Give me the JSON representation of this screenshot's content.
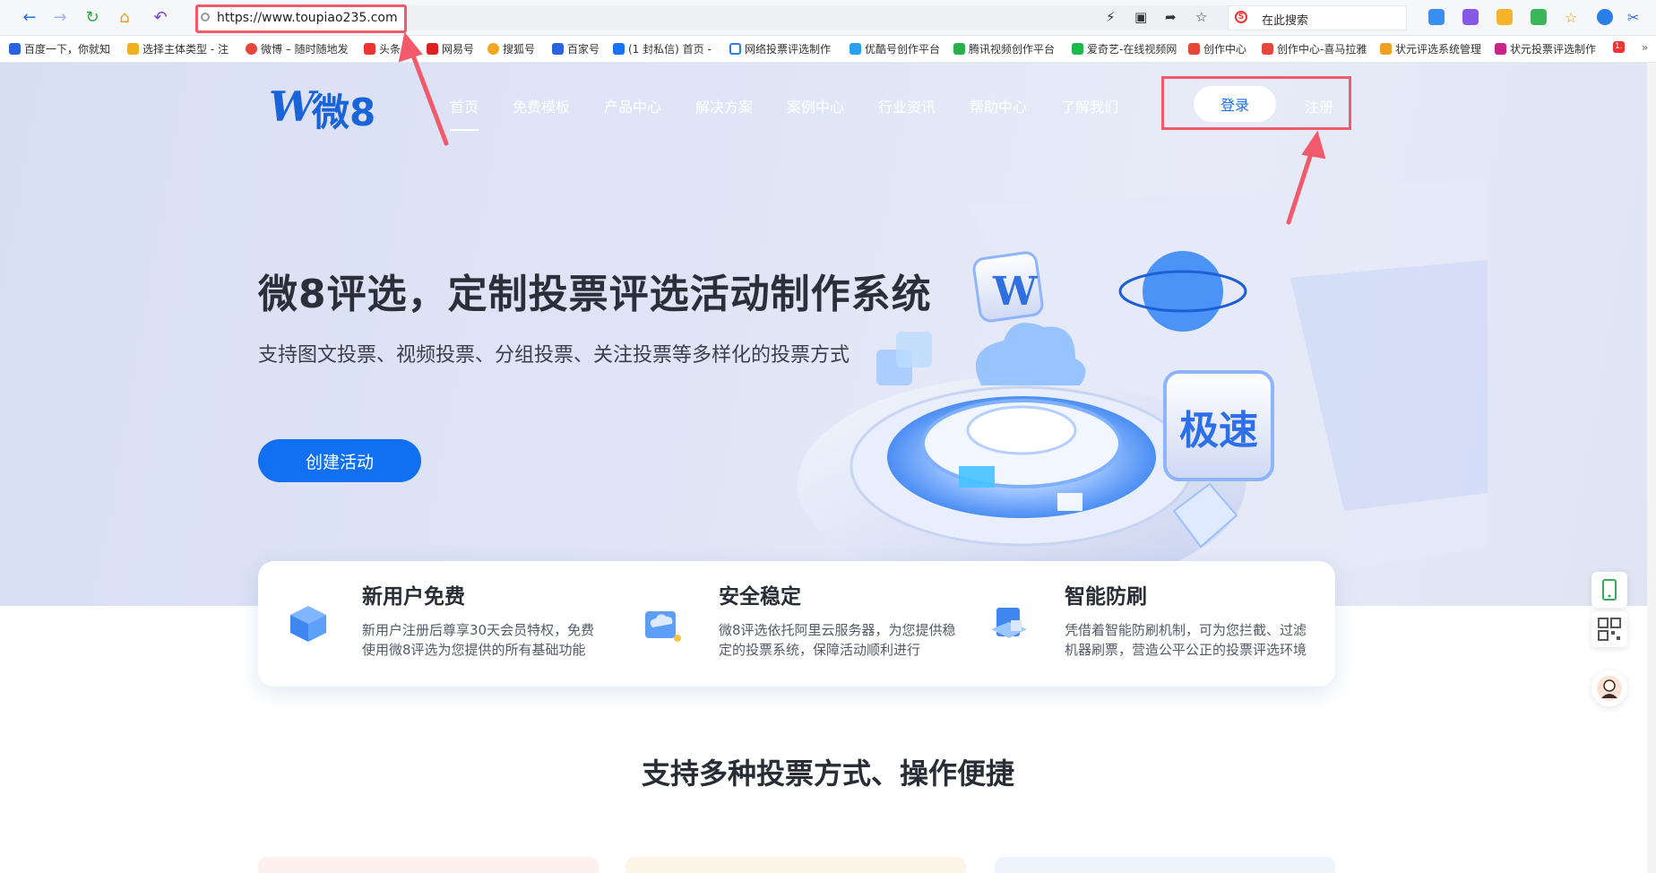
{
  "browser": {
    "url": "https://www.toupiao235.com",
    "search_placeholder": "在此搜索",
    "bookmarks": [
      "百度一下，你就知",
      "选择主体类型 - 注",
      "微博 – 随时随地发",
      "头条号",
      "网易号",
      "搜狐号",
      "百家号",
      "(1 封私信) 首页 -",
      "网络投票评选制作",
      "优酷号创作平台",
      "腾讯视频创作平台",
      "爱奇艺-在线视频网",
      "创作中心",
      "创作中心-喜马拉雅",
      "状元评选系统管理",
      "状元投票评选制作"
    ],
    "bookmark_badge": "1."
  },
  "site": {
    "logo_letter": "W",
    "logo_text": "微8",
    "nav": [
      "首页",
      "免费模板",
      "产品中心",
      "解决方案",
      "案例中心",
      "行业资讯",
      "帮助中心",
      "了解我们"
    ],
    "login_label": "登录",
    "register_label": "注册"
  },
  "hero": {
    "title": "微8评选，定制投票评选活动制作系统",
    "subtitle": "支持图文投票、视频投票、分组投票、关注投票等多样化的投票方式",
    "cta_label": "创建活动",
    "badge_text": "极速"
  },
  "features": [
    {
      "title": "新用户免费",
      "desc": "新用户注册后尊享30天会员特权，免费使用微8评选为您提供的所有基础功能"
    },
    {
      "title": "安全稳定",
      "desc": "微8评选依托阿里云服务器，为您提供稳定的投票系统，保障活动顺利进行"
    },
    {
      "title": "智能防刷",
      "desc": "凭借着智能防刷机制，可为您拦截、过滤机器刷票，营造公平公正的投票评选环境"
    }
  ],
  "section": {
    "title": "支持多种投票方式、操作便捷"
  },
  "colors": {
    "brand_blue": "#1170f2",
    "highlight_red": "#f05a6a"
  }
}
